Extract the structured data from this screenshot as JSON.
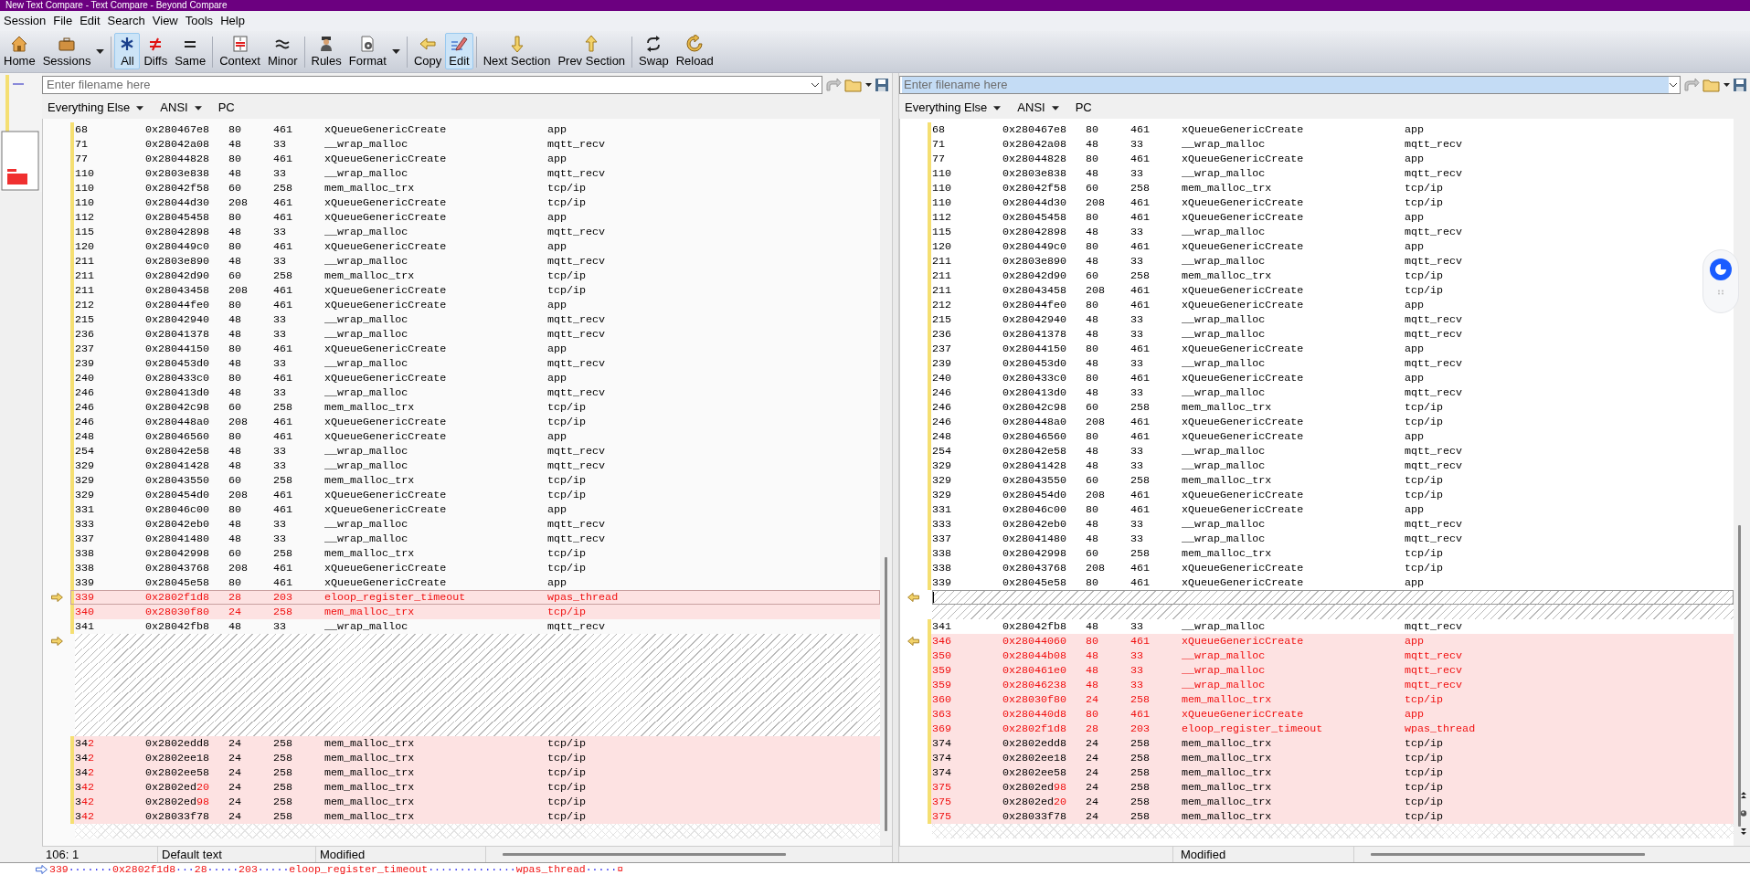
{
  "window": {
    "title": "New Text Compare - Text Compare - Beyond Compare"
  },
  "menu": [
    "Session",
    "File",
    "Edit",
    "Search",
    "View",
    "Tools",
    "Help"
  ],
  "toolbar": {
    "groups": [
      [
        {
          "label": "Home"
        },
        {
          "label": "Sessions",
          "has_menu": true
        }
      ],
      [
        {
          "label": "All",
          "selected": true
        },
        {
          "label": "Diffs",
          "selected": false
        },
        {
          "label": "Same",
          "selected": false
        }
      ],
      [
        {
          "label": "Context"
        },
        {
          "label": "Minor"
        }
      ],
      [
        {
          "label": "Rules"
        },
        {
          "label": "Format",
          "has_menu": true
        }
      ],
      [
        {
          "label": "Copy",
          "selected": false
        },
        {
          "label": "Edit",
          "selected": true
        }
      ],
      [
        {
          "label": "Next Section"
        },
        {
          "label": "Prev Section"
        }
      ],
      [
        {
          "label": "Swap"
        },
        {
          "label": "Reload"
        }
      ]
    ]
  },
  "left": {
    "filename": {
      "placeholder": "Enter filename here",
      "focused": false
    },
    "format": [
      {
        "label": "Everything Else",
        "has_menu": true
      },
      {
        "label": "ANSI",
        "has_menu": true
      },
      {
        "label": "PC",
        "has_menu": false
      }
    ],
    "rows": [
      {
        "kind": "same",
        "cells": [
          "68",
          "0x280467e8",
          "80",
          "461",
          "xQueueGenericCreate",
          "app"
        ]
      },
      {
        "kind": "same",
        "cells": [
          "71",
          "0x28042a08",
          "48",
          "33",
          "__wrap_malloc",
          "mqtt_recv"
        ]
      },
      {
        "kind": "same",
        "cells": [
          "77",
          "0x28044828",
          "80",
          "461",
          "xQueueGenericCreate",
          "app"
        ]
      },
      {
        "kind": "same",
        "cells": [
          "110",
          "0x2803e838",
          "48",
          "33",
          "__wrap_malloc",
          "mqtt_recv"
        ]
      },
      {
        "kind": "same",
        "cells": [
          "110",
          "0x28042f58",
          "60",
          "258",
          "mem_malloc_trx",
          "tcp/ip"
        ]
      },
      {
        "kind": "same",
        "cells": [
          "110",
          "0x28044d30",
          "208",
          "461",
          "xQueueGenericCreate",
          "tcp/ip"
        ]
      },
      {
        "kind": "same",
        "cells": [
          "112",
          "0x28045458",
          "80",
          "461",
          "xQueueGenericCreate",
          "app"
        ]
      },
      {
        "kind": "same",
        "cells": [
          "115",
          "0x28042898",
          "48",
          "33",
          "__wrap_malloc",
          "mqtt_recv"
        ]
      },
      {
        "kind": "same",
        "cells": [
          "120",
          "0x280449c0",
          "80",
          "461",
          "xQueueGenericCreate",
          "app"
        ]
      },
      {
        "kind": "same",
        "cells": [
          "211",
          "0x2803e890",
          "48",
          "33",
          "__wrap_malloc",
          "mqtt_recv"
        ]
      },
      {
        "kind": "same",
        "cells": [
          "211",
          "0x28042d90",
          "60",
          "258",
          "mem_malloc_trx",
          "tcp/ip"
        ]
      },
      {
        "kind": "same",
        "cells": [
          "211",
          "0x28043458",
          "208",
          "461",
          "xQueueGenericCreate",
          "tcp/ip"
        ]
      },
      {
        "kind": "same",
        "cells": [
          "212",
          "0x28044fe0",
          "80",
          "461",
          "xQueueGenericCreate",
          "app"
        ]
      },
      {
        "kind": "same",
        "cells": [
          "215",
          "0x28042940",
          "48",
          "33",
          "__wrap_malloc",
          "mqtt_recv"
        ]
      },
      {
        "kind": "same",
        "cells": [
          "236",
          "0x28041378",
          "48",
          "33",
          "__wrap_malloc",
          "mqtt_recv"
        ]
      },
      {
        "kind": "same",
        "cells": [
          "237",
          "0x28044150",
          "80",
          "461",
          "xQueueGenericCreate",
          "app"
        ]
      },
      {
        "kind": "same",
        "cells": [
          "239",
          "0x280453d0",
          "48",
          "33",
          "__wrap_malloc",
          "mqtt_recv"
        ]
      },
      {
        "kind": "same",
        "cells": [
          "240",
          "0x280433c0",
          "80",
          "461",
          "xQueueGenericCreate",
          "app"
        ]
      },
      {
        "kind": "same",
        "cells": [
          "246",
          "0x280413d0",
          "48",
          "33",
          "__wrap_malloc",
          "mqtt_recv"
        ]
      },
      {
        "kind": "same",
        "cells": [
          "246",
          "0x28042c98",
          "60",
          "258",
          "mem_malloc_trx",
          "tcp/ip"
        ]
      },
      {
        "kind": "same",
        "cells": [
          "246",
          "0x280448a0",
          "208",
          "461",
          "xQueueGenericCreate",
          "tcp/ip"
        ]
      },
      {
        "kind": "same",
        "cells": [
          "248",
          "0x28046560",
          "80",
          "461",
          "xQueueGenericCreate",
          "app"
        ]
      },
      {
        "kind": "same",
        "cells": [
          "254",
          "0x28042e58",
          "48",
          "33",
          "__wrap_malloc",
          "mqtt_recv"
        ]
      },
      {
        "kind": "same",
        "cells": [
          "329",
          "0x28041428",
          "48",
          "33",
          "__wrap_malloc",
          "mqtt_recv"
        ]
      },
      {
        "kind": "same",
        "cells": [
          "329",
          "0x28043550",
          "60",
          "258",
          "mem_malloc_trx",
          "tcp/ip"
        ]
      },
      {
        "kind": "same",
        "cells": [
          "329",
          "0x280454d0",
          "208",
          "461",
          "xQueueGenericCreate",
          "tcp/ip"
        ]
      },
      {
        "kind": "same",
        "cells": [
          "331",
          "0x28046c00",
          "80",
          "461",
          "xQueueGenericCreate",
          "app"
        ]
      },
      {
        "kind": "same",
        "cells": [
          "333",
          "0x28042eb0",
          "48",
          "33",
          "__wrap_malloc",
          "mqtt_recv"
        ]
      },
      {
        "kind": "same",
        "cells": [
          "337",
          "0x28041480",
          "48",
          "33",
          "__wrap_malloc",
          "mqtt_recv"
        ]
      },
      {
        "kind": "same",
        "cells": [
          "338",
          "0x28042998",
          "60",
          "258",
          "mem_malloc_trx",
          "tcp/ip"
        ]
      },
      {
        "kind": "same",
        "cells": [
          "338",
          "0x28043768",
          "208",
          "461",
          "xQueueGenericCreate",
          "tcp/ip"
        ]
      },
      {
        "kind": "same",
        "cells": [
          "339",
          "0x28045e58",
          "80",
          "461",
          "xQueueGenericCreate",
          "app"
        ]
      },
      {
        "kind": "diff",
        "all_changed": true,
        "marker": true,
        "current": true,
        "cells": [
          "339",
          "0x2802f1d8",
          "28",
          "203",
          "eloop_register_timeout",
          "wpas_thread"
        ]
      },
      {
        "kind": "diff",
        "all_changed": true,
        "cells": [
          "340",
          "0x28030f80",
          "24",
          "258",
          "mem_malloc_trx",
          "tcp/ip"
        ]
      },
      {
        "kind": "same",
        "cells": [
          "341",
          "0x28042fb8",
          "48",
          "33",
          "__wrap_malloc",
          "mqtt_recv"
        ]
      },
      {
        "kind": "gap",
        "marker": true
      },
      {
        "kind": "gap"
      },
      {
        "kind": "gap"
      },
      {
        "kind": "gap"
      },
      {
        "kind": "gap"
      },
      {
        "kind": "gap"
      },
      {
        "kind": "gap"
      },
      {
        "kind": "diff",
        "cells": [
          {
            "same": "34",
            "diff": "2"
          },
          "0x2802edd8",
          "24",
          "258",
          "mem_malloc_trx",
          "tcp/ip"
        ]
      },
      {
        "kind": "diff",
        "cells": [
          {
            "same": "34",
            "diff": "2"
          },
          "0x2802ee18",
          "24",
          "258",
          "mem_malloc_trx",
          "tcp/ip"
        ]
      },
      {
        "kind": "diff",
        "cells": [
          {
            "same": "34",
            "diff": "2"
          },
          "0x2802ee58",
          "24",
          "258",
          "mem_malloc_trx",
          "tcp/ip"
        ]
      },
      {
        "kind": "diff",
        "cells": [
          {
            "same": "3",
            "diff": "42"
          },
          {
            "same": "0x2802ed",
            "diff": "20"
          },
          "24",
          "258",
          "mem_malloc_trx",
          "tcp/ip"
        ]
      },
      {
        "kind": "diff",
        "cells": [
          {
            "same": "3",
            "diff": "42"
          },
          {
            "same": "0x2802ed",
            "diff": "98"
          },
          "24",
          "258",
          "mem_malloc_trx",
          "tcp/ip"
        ]
      },
      {
        "kind": "diff",
        "cells": [
          {
            "same": "3",
            "diff": "42"
          },
          "0x28033f78",
          "24",
          "258",
          "mem_malloc_trx",
          "tcp/ip"
        ]
      }
    ],
    "status": [
      "106: 1",
      "Default text",
      "Modified"
    ]
  },
  "right": {
    "filename": {
      "placeholder": "Enter filename here",
      "focused": true
    },
    "format": [
      {
        "label": "Everything Else",
        "has_menu": true
      },
      {
        "label": "ANSI",
        "has_menu": true
      },
      {
        "label": "PC",
        "has_menu": false
      }
    ],
    "rows": [
      {
        "kind": "same",
        "cells": [
          "68",
          "0x280467e8",
          "80",
          "461",
          "xQueueGenericCreate",
          "app"
        ]
      },
      {
        "kind": "same",
        "cells": [
          "71",
          "0x28042a08",
          "48",
          "33",
          "__wrap_malloc",
          "mqtt_recv"
        ]
      },
      {
        "kind": "same",
        "cells": [
          "77",
          "0x28044828",
          "80",
          "461",
          "xQueueGenericCreate",
          "app"
        ]
      },
      {
        "kind": "same",
        "cells": [
          "110",
          "0x2803e838",
          "48",
          "33",
          "__wrap_malloc",
          "mqtt_recv"
        ]
      },
      {
        "kind": "same",
        "cells": [
          "110",
          "0x28042f58",
          "60",
          "258",
          "mem_malloc_trx",
          "tcp/ip"
        ]
      },
      {
        "kind": "same",
        "cells": [
          "110",
          "0x28044d30",
          "208",
          "461",
          "xQueueGenericCreate",
          "tcp/ip"
        ]
      },
      {
        "kind": "same",
        "cells": [
          "112",
          "0x28045458",
          "80",
          "461",
          "xQueueGenericCreate",
          "app"
        ]
      },
      {
        "kind": "same",
        "cells": [
          "115",
          "0x28042898",
          "48",
          "33",
          "__wrap_malloc",
          "mqtt_recv"
        ]
      },
      {
        "kind": "same",
        "cells": [
          "120",
          "0x280449c0",
          "80",
          "461",
          "xQueueGenericCreate",
          "app"
        ]
      },
      {
        "kind": "same",
        "cells": [
          "211",
          "0x2803e890",
          "48",
          "33",
          "__wrap_malloc",
          "mqtt_recv"
        ]
      },
      {
        "kind": "same",
        "cells": [
          "211",
          "0x28042d90",
          "60",
          "258",
          "mem_malloc_trx",
          "tcp/ip"
        ]
      },
      {
        "kind": "same",
        "cells": [
          "211",
          "0x28043458",
          "208",
          "461",
          "xQueueGenericCreate",
          "tcp/ip"
        ]
      },
      {
        "kind": "same",
        "cells": [
          "212",
          "0x28044fe0",
          "80",
          "461",
          "xQueueGenericCreate",
          "app"
        ]
      },
      {
        "kind": "same",
        "cells": [
          "215",
          "0x28042940",
          "48",
          "33",
          "__wrap_malloc",
          "mqtt_recv"
        ]
      },
      {
        "kind": "same",
        "cells": [
          "236",
          "0x28041378",
          "48",
          "33",
          "__wrap_malloc",
          "mqtt_recv"
        ]
      },
      {
        "kind": "same",
        "cells": [
          "237",
          "0x28044150",
          "80",
          "461",
          "xQueueGenericCreate",
          "app"
        ]
      },
      {
        "kind": "same",
        "cells": [
          "239",
          "0x280453d0",
          "48",
          "33",
          "__wrap_malloc",
          "mqtt_recv"
        ]
      },
      {
        "kind": "same",
        "cells": [
          "240",
          "0x280433c0",
          "80",
          "461",
          "xQueueGenericCreate",
          "app"
        ]
      },
      {
        "kind": "same",
        "cells": [
          "246",
          "0x280413d0",
          "48",
          "33",
          "__wrap_malloc",
          "mqtt_recv"
        ]
      },
      {
        "kind": "same",
        "cells": [
          "246",
          "0x28042c98",
          "60",
          "258",
          "mem_malloc_trx",
          "tcp/ip"
        ]
      },
      {
        "kind": "same",
        "cells": [
          "246",
          "0x280448a0",
          "208",
          "461",
          "xQueueGenericCreate",
          "tcp/ip"
        ]
      },
      {
        "kind": "same",
        "cells": [
          "248",
          "0x28046560",
          "80",
          "461",
          "xQueueGenericCreate",
          "app"
        ]
      },
      {
        "kind": "same",
        "cells": [
          "254",
          "0x28042e58",
          "48",
          "33",
          "__wrap_malloc",
          "mqtt_recv"
        ]
      },
      {
        "kind": "same",
        "cells": [
          "329",
          "0x28041428",
          "48",
          "33",
          "__wrap_malloc",
          "mqtt_recv"
        ]
      },
      {
        "kind": "same",
        "cells": [
          "329",
          "0x28043550",
          "60",
          "258",
          "mem_malloc_trx",
          "tcp/ip"
        ]
      },
      {
        "kind": "same",
        "cells": [
          "329",
          "0x280454d0",
          "208",
          "461",
          "xQueueGenericCreate",
          "tcp/ip"
        ]
      },
      {
        "kind": "same",
        "cells": [
          "331",
          "0x28046c00",
          "80",
          "461",
          "xQueueGenericCreate",
          "app"
        ]
      },
      {
        "kind": "same",
        "cells": [
          "333",
          "0x28042eb0",
          "48",
          "33",
          "__wrap_malloc",
          "mqtt_recv"
        ]
      },
      {
        "kind": "same",
        "cells": [
          "337",
          "0x28041480",
          "48",
          "33",
          "__wrap_malloc",
          "mqtt_recv"
        ]
      },
      {
        "kind": "same",
        "cells": [
          "338",
          "0x28042998",
          "60",
          "258",
          "mem_malloc_trx",
          "tcp/ip"
        ]
      },
      {
        "kind": "same",
        "cells": [
          "338",
          "0x28043768",
          "208",
          "461",
          "xQueueGenericCreate",
          "tcp/ip"
        ]
      },
      {
        "kind": "same",
        "cells": [
          "339",
          "0x28045e58",
          "80",
          "461",
          "xQueueGenericCreate",
          "app"
        ]
      },
      {
        "kind": "gap",
        "marker": true,
        "current": true
      },
      {
        "kind": "gap"
      },
      {
        "kind": "same",
        "cells": [
          "341",
          "0x28042fb8",
          "48",
          "33",
          "__wrap_malloc",
          "mqtt_recv"
        ]
      },
      {
        "kind": "diff",
        "all_changed": true,
        "marker": true,
        "cells": [
          "346",
          "0x28044060",
          "80",
          "461",
          "xQueueGenericCreate",
          "app"
        ]
      },
      {
        "kind": "diff",
        "all_changed": true,
        "cells": [
          "350",
          "0x28044b08",
          "48",
          "33",
          "__wrap_malloc",
          "mqtt_recv"
        ]
      },
      {
        "kind": "diff",
        "all_changed": true,
        "cells": [
          "359",
          "0x280461e0",
          "48",
          "33",
          "__wrap_malloc",
          "mqtt_recv"
        ]
      },
      {
        "kind": "diff",
        "all_changed": true,
        "cells": [
          "359",
          "0x28046238",
          "48",
          "33",
          "__wrap_malloc",
          "mqtt_recv"
        ]
      },
      {
        "kind": "diff",
        "all_changed": true,
        "cells": [
          "360",
          "0x28030f80",
          "24",
          "258",
          "mem_malloc_trx",
          "tcp/ip"
        ]
      },
      {
        "kind": "diff",
        "all_changed": true,
        "cells": [
          "363",
          "0x280440d8",
          "80",
          "461",
          "xQueueGenericCreate",
          "app"
        ]
      },
      {
        "kind": "diff",
        "all_changed": true,
        "cells": [
          "369",
          "0x2802f1d8",
          "28",
          "203",
          "eloop_register_timeout",
          "wpas_thread"
        ]
      },
      {
        "kind": "diff",
        "cells": [
          "374",
          "0x2802edd8",
          "24",
          "258",
          "mem_malloc_trx",
          "tcp/ip"
        ]
      },
      {
        "kind": "diff",
        "cells": [
          "374",
          "0x2802ee18",
          "24",
          "258",
          "mem_malloc_trx",
          "tcp/ip"
        ]
      },
      {
        "kind": "diff",
        "cells": [
          "374",
          "0x2802ee58",
          "24",
          "258",
          "mem_malloc_trx",
          "tcp/ip"
        ]
      },
      {
        "kind": "diff",
        "cells": [
          {
            "diff": "375"
          },
          {
            "same": "0x2802ed",
            "diff": "98"
          },
          "24",
          "258",
          "mem_malloc_trx",
          "tcp/ip"
        ]
      },
      {
        "kind": "diff",
        "cells": [
          {
            "diff": "375"
          },
          {
            "same": "0x2802ed",
            "diff": "20"
          },
          "24",
          "258",
          "mem_malloc_trx",
          "tcp/ip"
        ]
      },
      {
        "kind": "diff",
        "cells": [
          {
            "diff": "375"
          },
          "0x28033f78",
          "24",
          "258",
          "mem_malloc_trx",
          "tcp/ip"
        ]
      }
    ],
    "status": [
      "Modified"
    ]
  },
  "current_line": "339·······0x2802f1d8···28·····203·····eloop_register_timeout··············wpas_thread·····¤"
}
